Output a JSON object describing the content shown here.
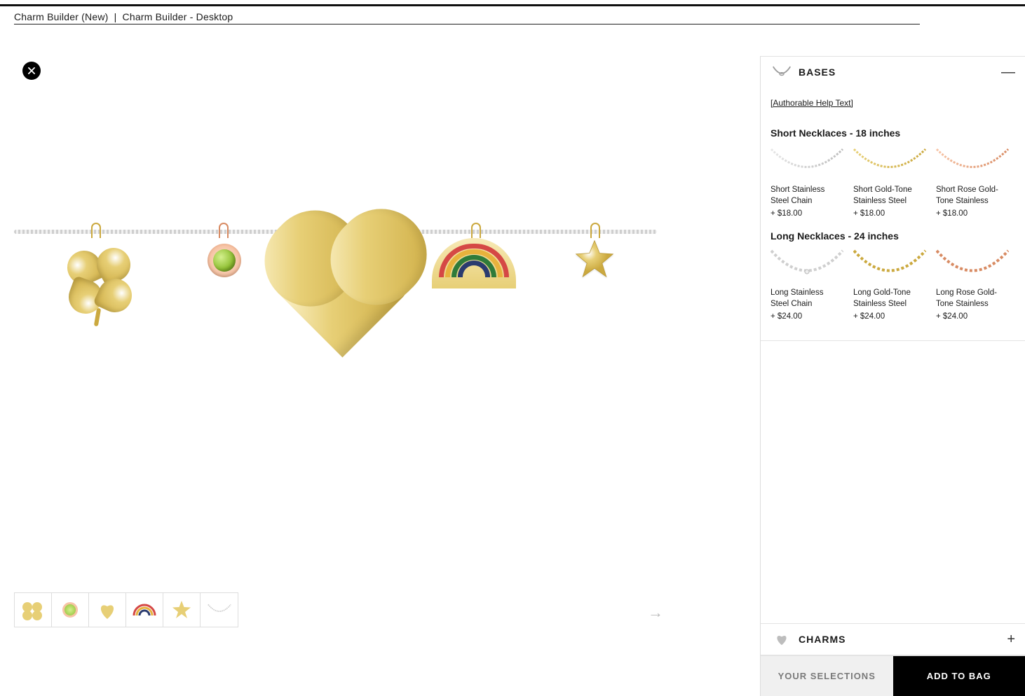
{
  "breadcrumb": {
    "a": "Charm Builder (New)",
    "sep": "|",
    "b": "Charm Builder - Desktop"
  },
  "accordions": {
    "bases": {
      "title": "BASES",
      "toggle": "—"
    },
    "charms": {
      "title": "CHARMS",
      "toggle": "+"
    }
  },
  "help_text": "[Authorable Help Text]",
  "sections": {
    "short": {
      "heading": "Short Necklaces - 18 inches",
      "items": [
        {
          "name": "Short Stainless Steel Chain",
          "price": "+ $18.00"
        },
        {
          "name": "Short Gold-Tone Stainless Steel",
          "price": "+ $18.00"
        },
        {
          "name": "Short Rose Gold-Tone Stainless",
          "price": "+ $18.00"
        }
      ]
    },
    "long": {
      "heading": "Long Necklaces - 24 inches",
      "items": [
        {
          "name": "Long Stainless Steel Chain",
          "price": "+ $24.00"
        },
        {
          "name": "Long Gold-Tone Stainless Steel",
          "price": "+ $24.00"
        },
        {
          "name": "Long Rose Gold-Tone Stainless",
          "price": "+ $24.00"
        }
      ]
    }
  },
  "bottom": {
    "selections": "YOUR SELECTIONS",
    "bag": "ADD TO BAG"
  },
  "thumbs": [
    "clover-icon",
    "gem-icon",
    "heart-icon",
    "rainbow-icon",
    "star-icon",
    "chain-icon"
  ],
  "charms_on_chain": [
    "clover",
    "gem",
    "heart",
    "rainbow",
    "star"
  ]
}
